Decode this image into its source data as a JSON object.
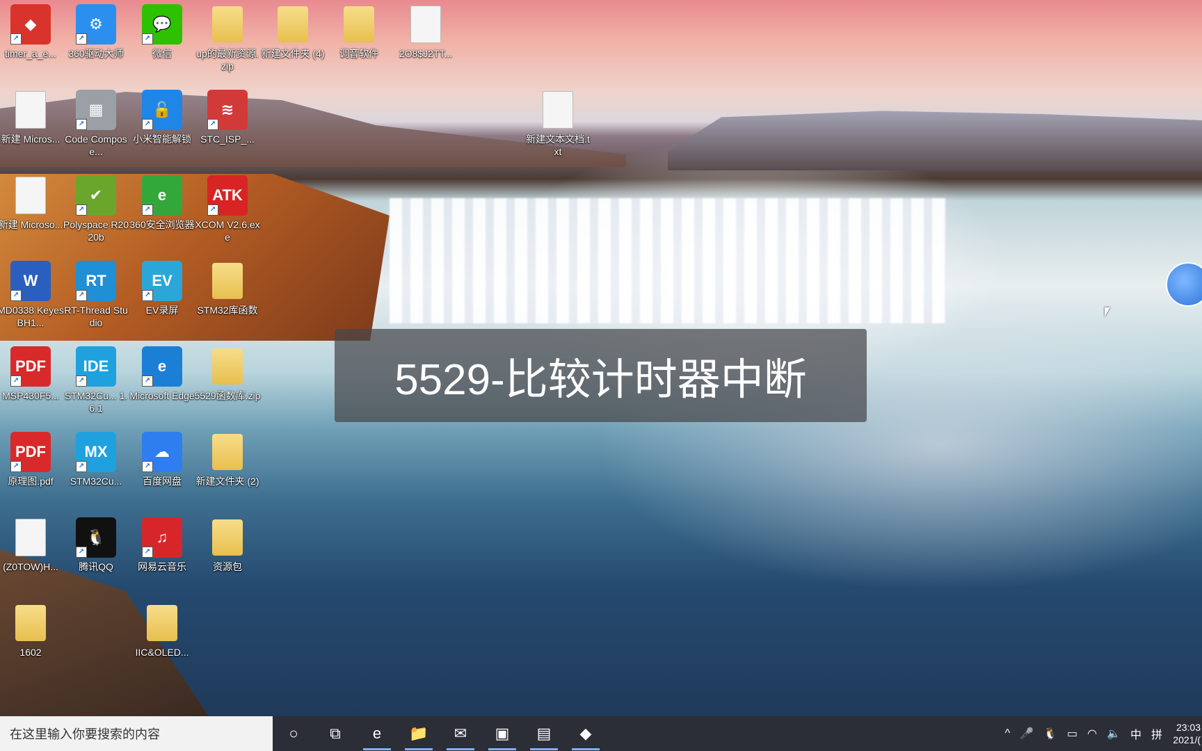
{
  "desktop_icons": [
    {
      "label": "timer_a_e...",
      "glyph": "◆",
      "color": "#d9342b"
    },
    {
      "label": "360驱动大师",
      "glyph": "⚙",
      "color": "#2b8ff0"
    },
    {
      "label": "微信",
      "glyph": "💬",
      "color": "#2dc100"
    },
    {
      "label": "up的最新资源.zip",
      "glyph": "",
      "color": "#f3cf6a"
    },
    {
      "label": "新建文件夹 (4)",
      "glyph": "",
      "color": "#f3cf6a"
    },
    {
      "label": "调音软件",
      "glyph": "",
      "color": "#f3cf6a"
    },
    {
      "label": "2O8$J2TT...",
      "glyph": "",
      "color": "#eeeeee"
    },
    {
      "label": "新建 Micros...",
      "glyph": "",
      "color": "#ffffff"
    },
    {
      "label": "Code Compose...",
      "glyph": "▦",
      "color": "#9aa0a6"
    },
    {
      "label": "小米智能解锁",
      "glyph": "🔓",
      "color": "#1f86e8"
    },
    {
      "label": "STC_ISP_...",
      "glyph": "≋",
      "color": "#d23a3a"
    },
    {
      "label": "新建文本文档.txt",
      "glyph": "",
      "color": "#f5f5f5"
    },
    {
      "label": "新建 Microso...",
      "glyph": "",
      "color": "#ffffff"
    },
    {
      "label": "Polyspace R2020b",
      "glyph": "✔",
      "color": "#6aa62b"
    },
    {
      "label": "360安全浏览器",
      "glyph": "e",
      "color": "#32a83a"
    },
    {
      "label": "XCOM V2.6.exe",
      "glyph": "ATK",
      "color": "#d82424"
    },
    {
      "label": "MD0338 Keyes BH1...",
      "glyph": "W",
      "color": "#2b5fbf"
    },
    {
      "label": "RT-Thread Studio",
      "glyph": "RT",
      "color": "#1f8fd6"
    },
    {
      "label": "EV录屏",
      "glyph": "EV",
      "color": "#2aa7d8"
    },
    {
      "label": "STM32库函数",
      "glyph": "",
      "color": "#f3cf6a"
    },
    {
      "label": "MSP430F5...",
      "glyph": "PDF",
      "color": "#d82a2a"
    },
    {
      "label": "STM32Cu... 1.6.1",
      "glyph": "IDE",
      "color": "#1fa1e0"
    },
    {
      "label": "Microsoft Edge",
      "glyph": "e",
      "color": "#1c7fd6"
    },
    {
      "label": "5529函数库.zip",
      "glyph": "",
      "color": "#f3cf6a"
    },
    {
      "label": "原理图.pdf",
      "glyph": "PDF",
      "color": "#d82a2a"
    },
    {
      "label": "STM32Cu...",
      "glyph": "MX",
      "color": "#1fa1e0"
    },
    {
      "label": "百度网盘",
      "glyph": "☁",
      "color": "#2e7ef0"
    },
    {
      "label": "新建文件夹 (2)",
      "glyph": "",
      "color": "#f3cf6a"
    },
    {
      "label": "(Z0TOW)H...",
      "glyph": "",
      "color": "#ffffff"
    },
    {
      "label": "腾讯QQ",
      "glyph": "🐧",
      "color": "#111111"
    },
    {
      "label": "网易云音乐",
      "glyph": "♫",
      "color": "#d7262a"
    },
    {
      "label": "资源包",
      "glyph": "",
      "color": "#f3cf6a"
    },
    {
      "label": "1602",
      "glyph": "",
      "color": "#f3cf6a"
    },
    {
      "label": "IIC&OLED...",
      "glyph": "",
      "color": "#f3cf6a"
    }
  ],
  "banner": {
    "title": "5529-比较计时器中断"
  },
  "taskbar": {
    "search_placeholder": "在这里输入你要搜索的内容",
    "pinned": [
      {
        "name": "cortana",
        "glyph": "○"
      },
      {
        "name": "task-view",
        "glyph": "⧉"
      },
      {
        "name": "edge",
        "glyph": "e"
      },
      {
        "name": "file-explorer",
        "glyph": "📁"
      },
      {
        "name": "mail",
        "glyph": "✉"
      },
      {
        "name": "3d-viewer",
        "glyph": "▣"
      },
      {
        "name": "notepad",
        "glyph": "▤"
      },
      {
        "name": "timer-app",
        "glyph": "◆"
      }
    ],
    "tray": {
      "overflow": "^",
      "ime_lang": "中",
      "ime_mode": "拼"
    },
    "clock_time": "23:03",
    "clock_date": "2021/("
  }
}
